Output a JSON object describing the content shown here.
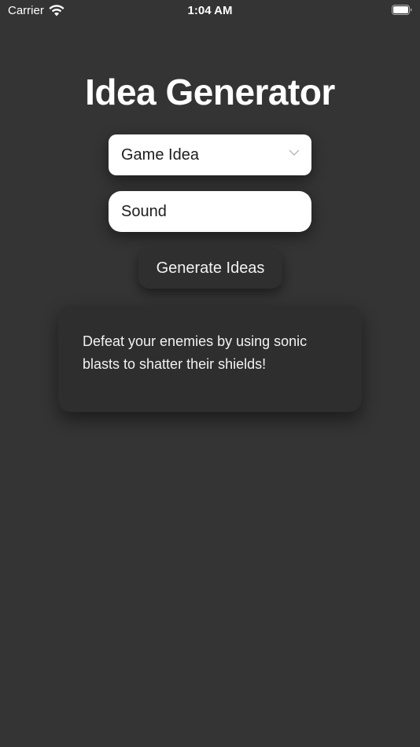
{
  "status_bar": {
    "carrier": "Carrier",
    "time": "1:04 AM",
    "wifi_icon": "wifi-icon",
    "battery_icon": "battery-icon"
  },
  "title": "Idea Generator",
  "picker": {
    "selected": "Game Idea",
    "icon": "chevron-down-icon"
  },
  "input": {
    "value": "Sound"
  },
  "generate_button": {
    "label": "Generate Ideas"
  },
  "result": {
    "text": "Defeat your enemies by using sonic blasts to shatter their shields!"
  },
  "colors": {
    "background": "#343434",
    "card": "#2e2e2e",
    "field": "#ffffff",
    "text": "#ffffff"
  }
}
